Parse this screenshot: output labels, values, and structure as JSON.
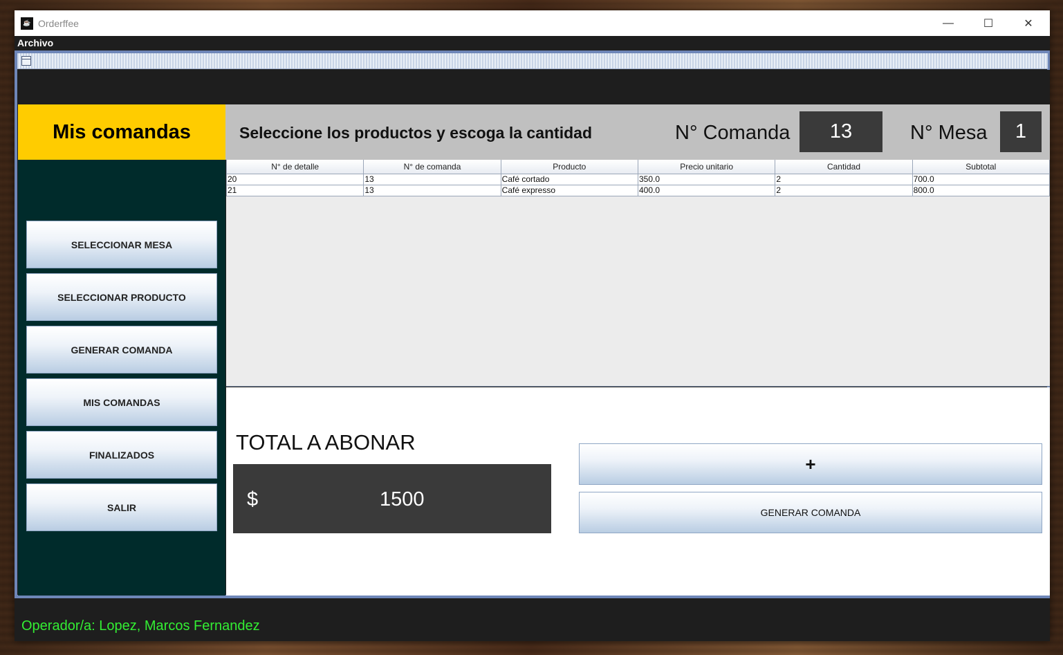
{
  "window": {
    "title": "Orderffee",
    "minimize": "—",
    "maximize": "☐",
    "close": "✕"
  },
  "menubar": {
    "archivo": "Archivo"
  },
  "sidebar": {
    "header": "Mis comandas",
    "buttons": [
      "SELECCIONAR MESA",
      "SELECCIONAR PRODUCTO",
      "GENERAR COMANDA",
      "MIS COMANDAS",
      "FINALIZADOS",
      "SALIR"
    ]
  },
  "header": {
    "instruction": "Seleccione los productos y escoga la cantidad",
    "comanda_label": "N° Comanda",
    "comanda_value": "13",
    "mesa_label": "N° Mesa",
    "mesa_value": "1"
  },
  "table": {
    "columns": [
      "N° de detalle",
      "N° de comanda",
      "Producto",
      "Precio unitario",
      "Cantidad",
      "Subtotal"
    ],
    "rows": [
      [
        "20",
        "13",
        "Café cortado",
        "350.0",
        "2",
        "700.0"
      ],
      [
        "21",
        "13",
        "Café expresso",
        "400.0",
        "2",
        "800.0"
      ]
    ]
  },
  "total": {
    "label": "TOTAL A ABONAR",
    "currency": "$",
    "value": "1500"
  },
  "actions": {
    "add_label": "+",
    "generate_label": "GENERAR COMANDA"
  },
  "status": {
    "operator": "Operador/a: Lopez, Marcos Fernandez",
    "color": "#33ee33"
  },
  "colors": {
    "accent_yellow": "#ffcc00",
    "sidebar_bg": "#002b2b",
    "dark_box": "#3a3a3a"
  }
}
